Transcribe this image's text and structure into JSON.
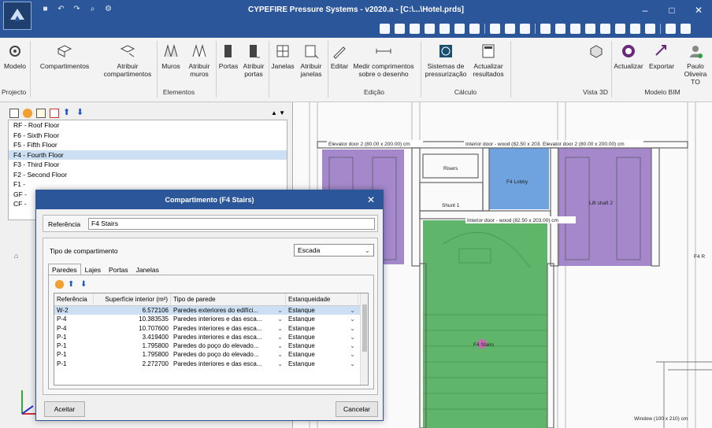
{
  "window": {
    "title": "CYPEFIRE Pressure Systems - v2020.a - [C:\\...\\Hotel.prds]",
    "controls": [
      "minimize",
      "maximize",
      "close"
    ]
  },
  "ribbon": {
    "buttons": [
      {
        "label": "Modelo"
      },
      {
        "label": "Compartimentos"
      },
      {
        "label": "Atribuir compartimentos"
      },
      {
        "label": "Muros"
      },
      {
        "label": "Atribuir muros"
      },
      {
        "label": "Portas"
      },
      {
        "label": "Atribuir portas"
      },
      {
        "label": "Janelas"
      },
      {
        "label": "Atribuir janelas"
      },
      {
        "label": "Editar"
      },
      {
        "label": "Medir comprimentos sobre o desenho"
      },
      {
        "label": "Sistemas de pressurização"
      },
      {
        "label": "Actualizar resultados"
      },
      {
        "label": ""
      },
      {
        "label": "Actualizar"
      },
      {
        "label": "Exportar"
      },
      {
        "label": "Paulo Oliveira TO"
      }
    ],
    "groups": {
      "projecto": "Projecto",
      "elementos": "Elementos",
      "edicao": "Edição",
      "calculo": "Cálculo",
      "vista3d": "Vista 3D",
      "bim": "Modelo BIM"
    }
  },
  "floors": [
    "RF - Roof Floor",
    "F6 - Sixth Floor",
    "F5 - Fifth Floor",
    "F4 - Fourth Floor",
    "F3 - Third Floor",
    "F2 - Second Floor",
    "F1 -",
    "GF -",
    "CF -"
  ],
  "selected_floor": "F4 - Fourth Floor",
  "drawing": {
    "labels": {
      "elevator_door": "Elevator door 2 (80.00 x 200.00) cm",
      "interior_door": "Interior door - wood (82.50 x 203.00) cm",
      "elevator_door_b": "Elevator door 2 (80.00 x 200.00) cm",
      "risers": "Risers",
      "lobby": "F4 Lobby",
      "shunt": "Shunt 1",
      "interior_door_b": "Interior door - wood (82.50 x 203.00) cm",
      "lift_shaft": "Lift shaft 2",
      "stairs": "F4 Stairs",
      "window": "Window (100 x 210) cm",
      "f4r": "F4 R"
    }
  },
  "dialog": {
    "title": "Compartimento (F4 Stairs)",
    "referencia_label": "Referência",
    "referencia_value": "F4 Stairs",
    "tipo_label": "Tipo de compartimento",
    "tipo_value": "Escada",
    "tabs": [
      "Paredes",
      "Lajes",
      "Portas",
      "Janelas"
    ],
    "columns": [
      "Referência",
      "Superfície interior (m²)",
      "Tipo de parede",
      "Estanqueidade"
    ],
    "rows": [
      {
        "ref": "W-2",
        "area": "6.572106",
        "tipo": "Paredes exteriores do edifíci...",
        "est": "Estanque"
      },
      {
        "ref": "P-4",
        "area": "10.383535",
        "tipo": "Paredes interiores e das esca...",
        "est": "Estanque"
      },
      {
        "ref": "P-4",
        "area": "10.707600",
        "tipo": "Paredes interiores e das esca...",
        "est": "Estanque"
      },
      {
        "ref": "P-1",
        "area": "3.419400",
        "tipo": "Paredes interiores e das esca...",
        "est": "Estanque"
      },
      {
        "ref": "P-1",
        "area": "1.795800",
        "tipo": "Paredes do poço do elevado...",
        "est": "Estanque"
      },
      {
        "ref": "P-1",
        "area": "1.795800",
        "tipo": "Paredes do poço do elevado...",
        "est": "Estanque"
      },
      {
        "ref": "P-1",
        "area": "2.272700",
        "tipo": "Paredes interiores e das esca...",
        "est": "Estanque"
      }
    ],
    "accept": "Aceitar",
    "cancel": "Cancelar"
  },
  "colors": {
    "titlebar": "#2b579a",
    "purple_room": "#9b7bc6",
    "blue_room": "#6fa3df",
    "green_room": "#5fb56a"
  }
}
